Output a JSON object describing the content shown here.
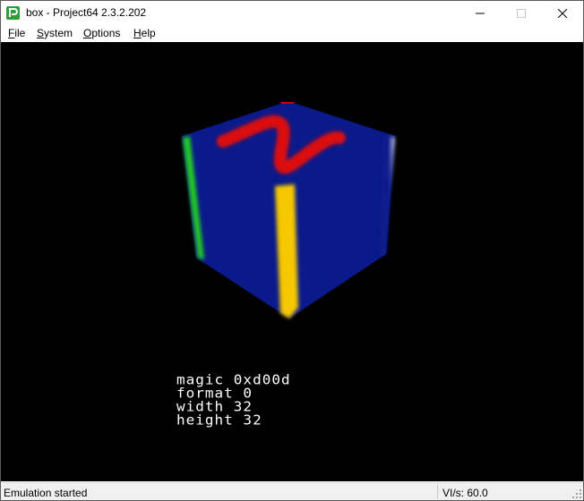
{
  "window": {
    "title": "box - Project64 2.3.2.202",
    "icon": "project64-app-icon"
  },
  "menu": [
    {
      "label": "File",
      "accel": "F",
      "rest": "ile"
    },
    {
      "label": "System",
      "accel": "S",
      "rest": "ystem"
    },
    {
      "label": "Options",
      "accel": "O",
      "rest": "ptions"
    },
    {
      "label": "Help",
      "accel": "H",
      "rest": "elp"
    }
  ],
  "viewport": {
    "background": "#000000",
    "cube_colors": {
      "front": "#0a1a8a",
      "top": "#cc0000",
      "left_stripe": "#22cc22",
      "right_stripe": "#ffffff",
      "bar": "#f5c800",
      "n_logo": "#dd1111"
    },
    "debug_lines": [
      "magic 0xd00d",
      "format 0",
      "width 32",
      "height 32"
    ]
  },
  "status": {
    "left": "Emulation started",
    "right": "VI/s: 60.0"
  }
}
